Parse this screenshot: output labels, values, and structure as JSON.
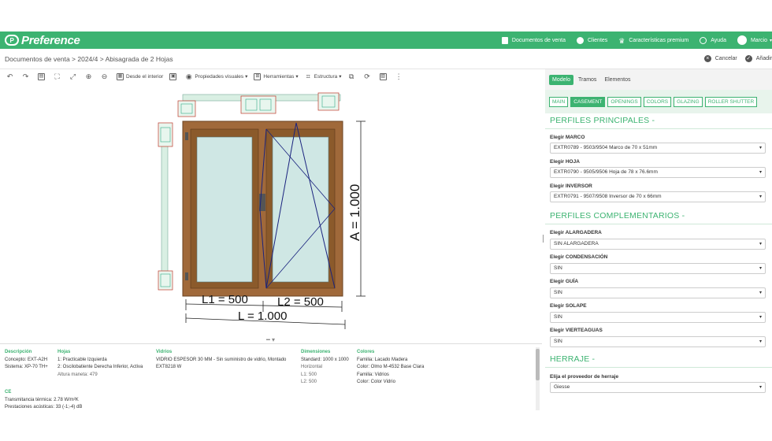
{
  "app": {
    "logo": "Preference",
    "logo_mark": "P"
  },
  "nav": {
    "items": [
      {
        "label": "Documentos de venta",
        "icon": "document-icon"
      },
      {
        "label": "Clientes",
        "icon": "users-icon"
      },
      {
        "label": "Características premium",
        "icon": "crown-icon"
      },
      {
        "label": "Ayuda",
        "icon": "help-icon"
      },
      {
        "label": "Marcio",
        "icon": "user-icon"
      }
    ]
  },
  "breadcrumb": "Documentos de venta > 2024/4 > Abisagrada de 2 Hojas",
  "actions": {
    "cancel": "Cancelar",
    "add": "Añadir"
  },
  "toolbar": {
    "from_inside": "Desde el interior",
    "visual_props": "Propiedades visuales",
    "tools": "Herramientas",
    "structure": "Estructura"
  },
  "drawing": {
    "height_label": "A = 1.000",
    "l1_label": "L1 = 500",
    "l2_label": "L2 = 500",
    "width_label": "L = 1.000"
  },
  "info": {
    "descripcion": {
      "title": "Descripción",
      "concepto": "Concepto:  EXT-A2H",
      "sistema": "Sistema:  XP-70 TH+"
    },
    "hojas": {
      "title": "Hojas",
      "h1": "1: Practicable Izquierda",
      "h2": "2: Oscilobatiente Derecha Inferior, Activa",
      "h3": "Altura maneta: 479"
    },
    "vidrios": {
      "title": "Vidrios",
      "v1": "VIDRIO ESPESOR 30 MM - Sin suministro de vidrio, Montado",
      "v2": "EXT8218 W"
    },
    "dimensiones": {
      "title": "Dimensiones",
      "d1": "Standard: 1000 x 1000",
      "d2": "Horizontal",
      "d3": "L1: 500",
      "d4": "L2: 500"
    },
    "colores": {
      "title": "Colores",
      "c1": "Familia:  Lacado Madera",
      "c2": "Color:  Olmo M-4532 Base Clara",
      "c3": "Familia:  Vidrios",
      "c4": "Color:  Color Vidrio"
    },
    "ce": {
      "title": "CE",
      "t1": "Transmitancia térmica: 2.78 W/m²K",
      "t2": "Prestaciones acústicas: 33 (-1;-4) dB"
    }
  },
  "right": {
    "tabs": [
      "Modelo",
      "Tramos",
      "Elementos"
    ],
    "subtabs": [
      "MAIN",
      "CASEMENT",
      "OPENINGS",
      "COLORS",
      "GLAZING",
      "ROLLER SHUTTER"
    ],
    "sec1": "PERFILES PRINCIPALES -",
    "marco_label": "Elegir MARCO",
    "marco_value": "EXTR0789 - 9503/9504 Marco de 70 x 51mm",
    "hoja_label": "Elegir HOJA",
    "hoja_value": "EXTR0790 - 9505/9506 Hoja de 78 x 76.6mm",
    "inversor_label": "Elegir INVERSOR",
    "inversor_value": "EXTR0791 - 9507/9508 Inversor de 70 x 66mm",
    "sec2": "PERFILES COMPLEMENTARIOS -",
    "alargadera_label": "Elegir ALARGADERA",
    "alargadera_value": "SIN ALARGADERA",
    "condensacion_label": "Elegir CONDENSACIÓN",
    "condensacion_value": "SIN",
    "guia_label": "Elegir GUÍA",
    "guia_value": "SIN",
    "solape_label": "Elegir SOLAPE",
    "solape_value": "SIN",
    "vierteaguas_label": "Elegir VIERTEAGUAS",
    "vierteaguas_value": "SIN",
    "sec3": "HERRAJE -",
    "herraje_label": "Elija el proveedor de herraje",
    "herraje_value": "Giesse"
  }
}
